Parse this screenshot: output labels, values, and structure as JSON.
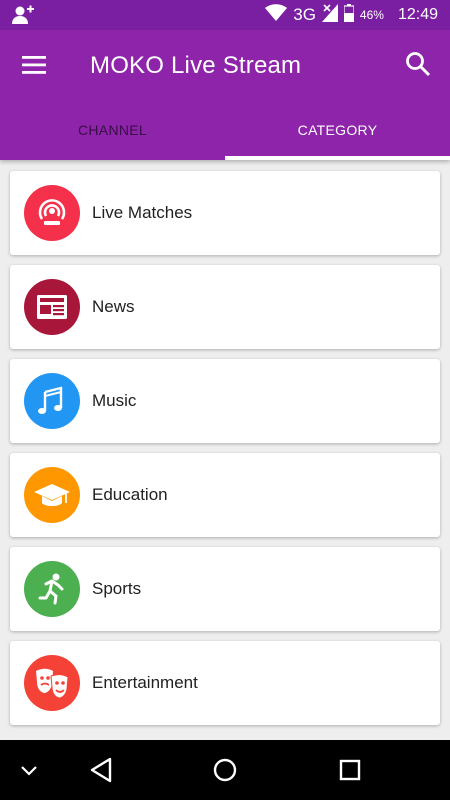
{
  "status_bar": {
    "network": "3G",
    "battery": "46%",
    "time": "12:49"
  },
  "app_bar": {
    "title": "MOKO Live Stream"
  },
  "tabs": [
    {
      "label": "CHANNEL",
      "selected": false
    },
    {
      "label": "CATEGORY",
      "selected": true
    }
  ],
  "categories": [
    {
      "label": "Live Matches",
      "icon": "live-broadcast-icon",
      "color": "#f4304a"
    },
    {
      "label": "News",
      "icon": "newspaper-icon",
      "color": "#a8173a"
    },
    {
      "label": "Music",
      "icon": "music-notes-icon",
      "color": "#2196f3"
    },
    {
      "label": "Education",
      "icon": "graduation-cap-icon",
      "color": "#ff9800"
    },
    {
      "label": "Sports",
      "icon": "running-person-icon",
      "color": "#4caf50"
    },
    {
      "label": "Entertainment",
      "icon": "theater-masks-icon",
      "color": "#f44336"
    }
  ],
  "colors": {
    "status_bar": "#7b1fa2",
    "app_bar": "#8e24aa",
    "background": "#eeeeee"
  }
}
